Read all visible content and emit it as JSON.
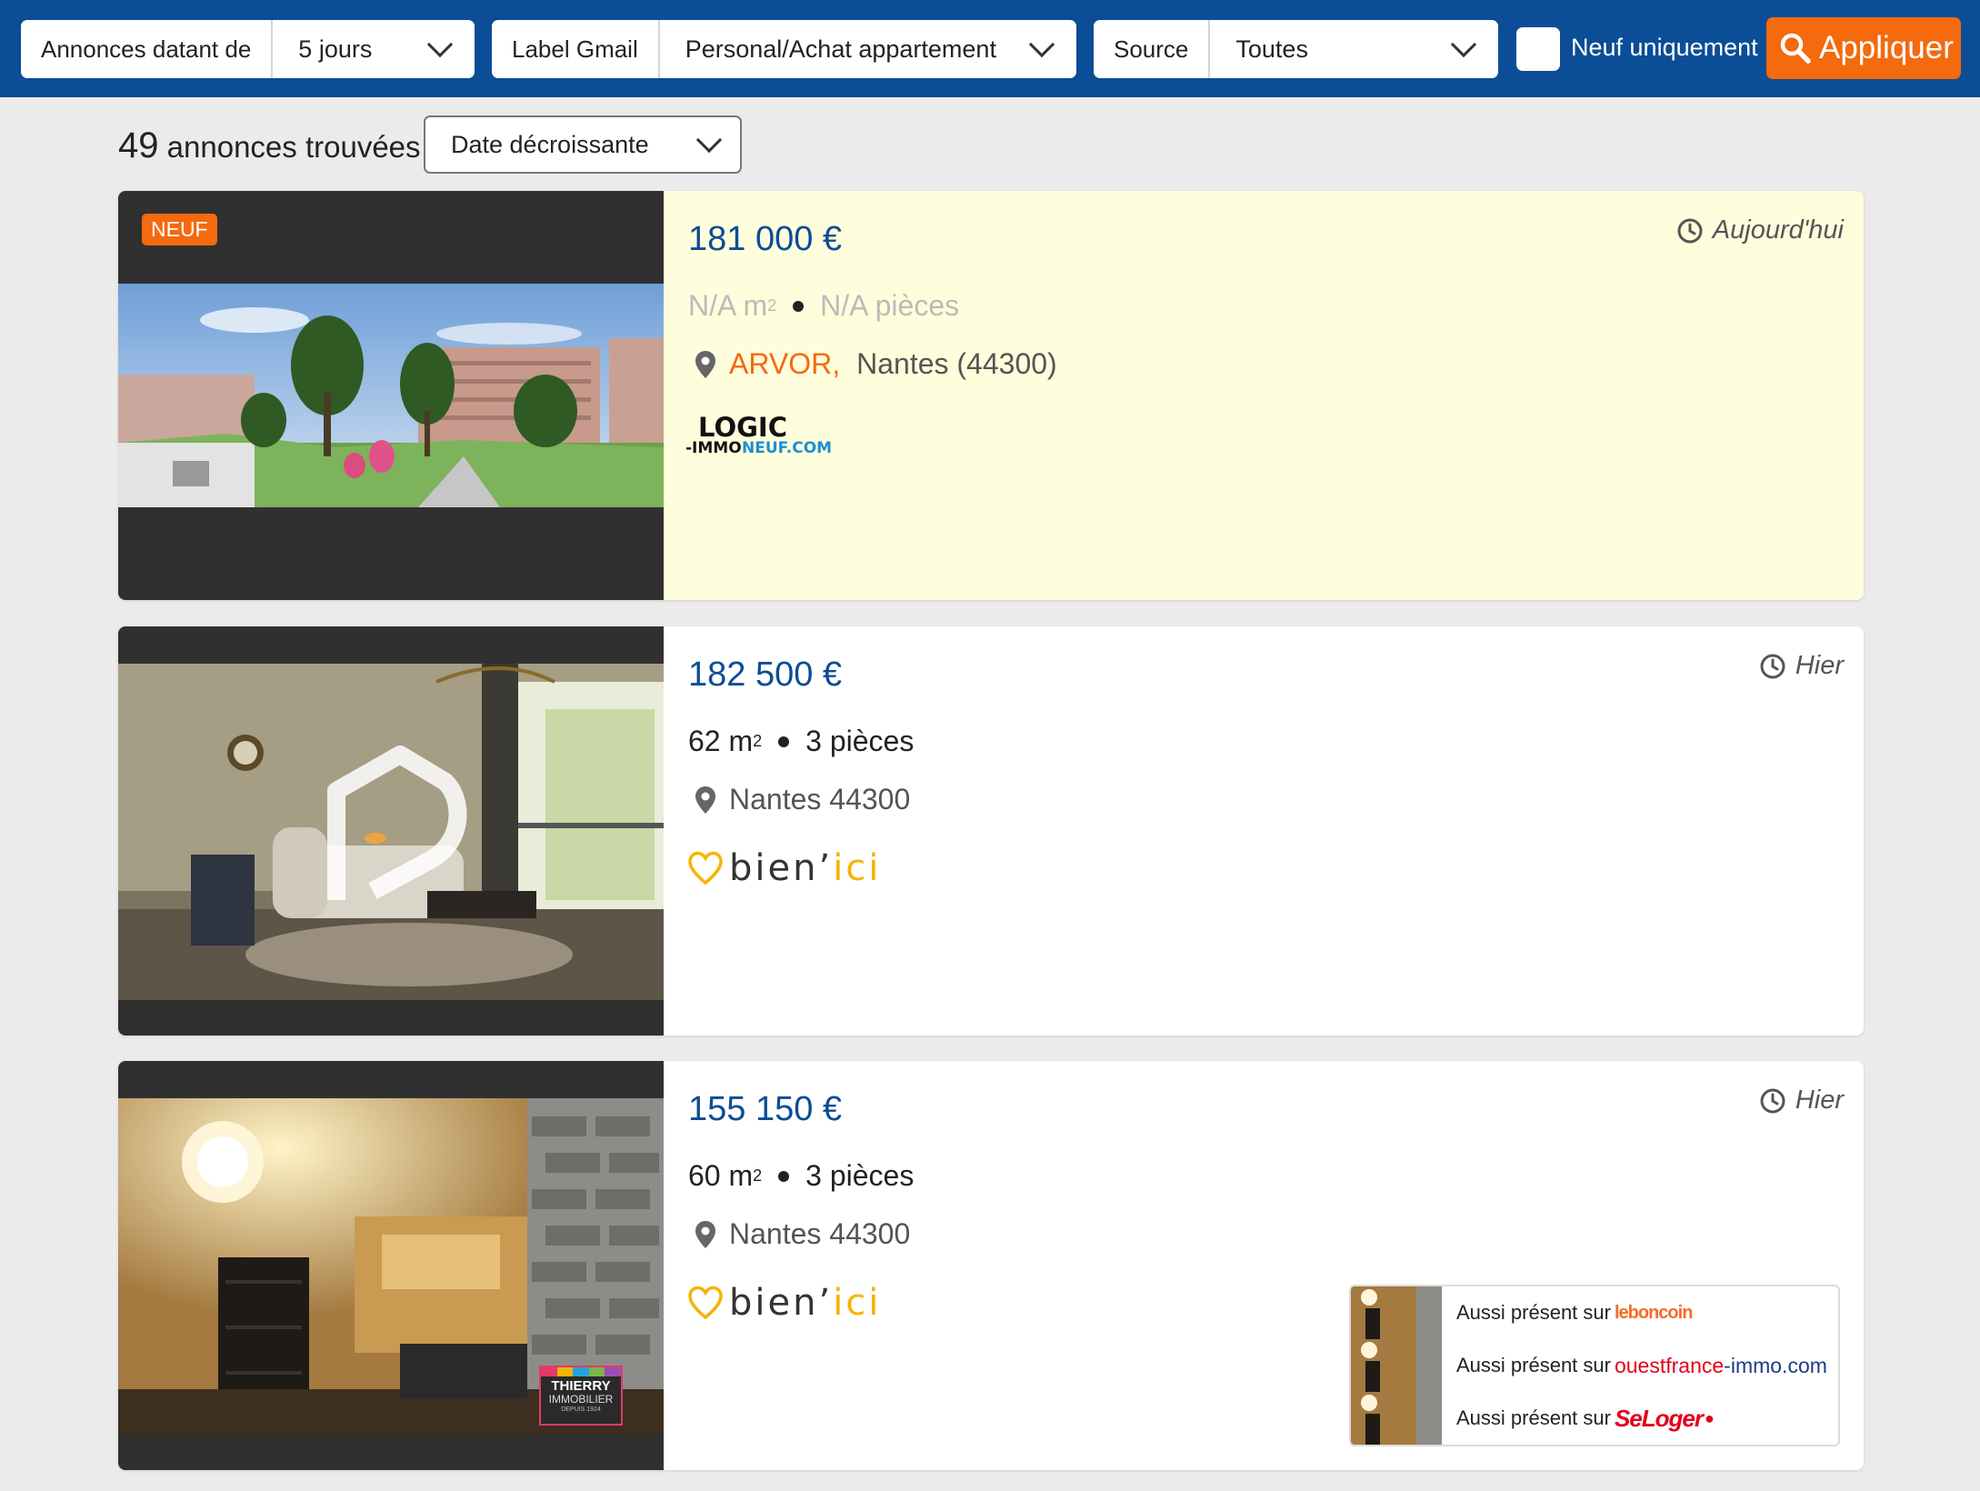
{
  "filters": {
    "date": {
      "label": "Annonces datant de",
      "value": "5 jours"
    },
    "gmail": {
      "label": "Label Gmail",
      "value": "Personal/Achat appartement"
    },
    "source": {
      "label": "Source",
      "value": "Toutes"
    },
    "new_only": {
      "label": "Neuf uniquement",
      "checked": false
    },
    "apply_label": "Appliquer"
  },
  "results": {
    "count": "49",
    "count_suffix": "annonces trouvées",
    "sort": "Date décroissante"
  },
  "listings": [
    {
      "badge": "NEUF",
      "price": "181 000 €",
      "date": "Aujourd'hui",
      "area": "N/A m",
      "rooms": "N/A pièces",
      "location_brand": "ARVOR,",
      "location": "Nantes (44300)",
      "source_logo": {
        "line1": "LOGIC",
        "line2a": "-IMMO",
        "line2b": "NEUF.COM"
      }
    },
    {
      "price": "182 500 €",
      "date": "Hier",
      "area": "62 m",
      "rooms": "3 pièces",
      "location": "Nantes 44300",
      "source_logo": {
        "part1": "bien’",
        "part2": "ici"
      }
    },
    {
      "price": "155 150 €",
      "date": "Hier",
      "area": "60 m",
      "rooms": "3 pièces",
      "location": "Nantes 44300",
      "source_logo": {
        "part1": "bien’",
        "part2": "ici"
      },
      "agency_logo": {
        "line1": "THIERRY",
        "line2": "IMMOBILIER",
        "line3": "DEPUIS 1924"
      },
      "also_present": [
        {
          "text": "Aussi présent sur",
          "source": "leboncoin",
          "color": "#f56b2a"
        },
        {
          "text": "Aussi présent sur",
          "source_a": "ouestfrance",
          "source_b": "-immo.com",
          "color_a": "#e2001a",
          "color_b": "#1d3a8a"
        },
        {
          "text": "Aussi présent sur",
          "source": "SeLoger",
          "color": "#e3001b"
        }
      ]
    }
  ],
  "sup2": "2",
  "colors": {
    "brand_blue": "#0b4d96",
    "accent_orange": "#f36a0f",
    "highlight": "#fffedc"
  }
}
